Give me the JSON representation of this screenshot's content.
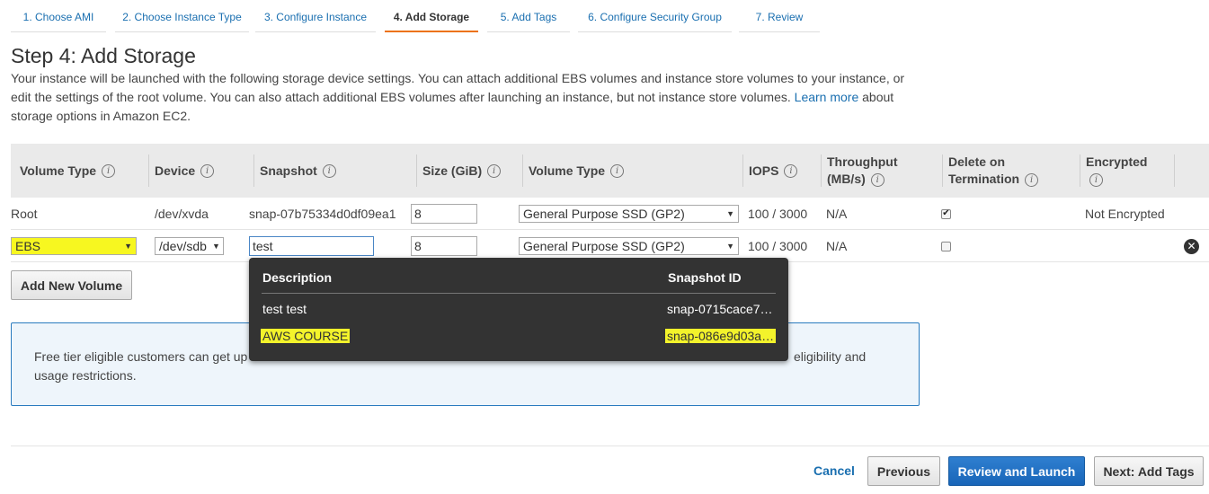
{
  "wizard": {
    "tabs": [
      {
        "label": "1. Choose AMI"
      },
      {
        "label": "2. Choose Instance Type"
      },
      {
        "label": "3. Configure Instance"
      },
      {
        "label": "4. Add Storage"
      },
      {
        "label": "5. Add Tags"
      },
      {
        "label": "6. Configure Security Group"
      },
      {
        "label": "7. Review"
      }
    ],
    "active_index": 3
  },
  "page": {
    "title": "Step 4: Add Storage",
    "intro_part1": "Your instance will be launched with the following storage device settings. You can attach additional EBS volumes and instance store volumes to your instance, or edit the settings of the root volume. You can also attach additional EBS volumes after launching an instance, but not instance store volumes.",
    "learn_more": "Learn more",
    "intro_part2": "about storage options in Amazon EC2."
  },
  "table": {
    "headers": {
      "volume_type": "Volume Type",
      "device": "Device",
      "snapshot": "Snapshot",
      "size": "Size (GiB)",
      "volume_type2": "Volume Type",
      "iops": "IOPS",
      "throughput_line1": "Throughput",
      "throughput_line2": "(MB/s)",
      "delete_line1": "Delete on",
      "delete_line2": "Termination",
      "encrypted": "Encrypted"
    },
    "rows": [
      {
        "volume_type": "Root",
        "device": "/dev/xvda",
        "snapshot": "snap-07b75334d0df09ea1",
        "size": "8",
        "ebs_type": "General Purpose SSD (GP2)",
        "iops": "100 / 3000",
        "throughput": "N/A",
        "delete_on_termination": true,
        "encrypted": "Not Encrypted"
      },
      {
        "volume_type": "EBS",
        "device": "/dev/sdb",
        "snapshot": "test",
        "size": "8",
        "ebs_type": "General Purpose SSD (GP2)",
        "iops": "100 / 3000",
        "throughput": "N/A",
        "delete_on_termination": false,
        "encrypted": ""
      }
    ]
  },
  "add_volume_button": "Add New Volume",
  "free_tier": {
    "text_part1": "Free tier eligible customers can get up",
    "text_part2": "eligibility and",
    "text_part3": "usage restrictions."
  },
  "snapshot_dropdown": {
    "header_description": "Description",
    "header_snapshot_id": "Snapshot ID",
    "items": [
      {
        "description": "test test",
        "snapshot_id": "snap-0715cace7…"
      },
      {
        "description": "AWS COURSE",
        "snapshot_id": "snap-086e9d03a…"
      }
    ]
  },
  "footer": {
    "cancel": "Cancel",
    "previous": "Previous",
    "review_launch": "Review and Launch",
    "next": "Next: Add Tags"
  },
  "colors": {
    "link": "#1a6fb0",
    "active_tab_underline": "#ec7211",
    "primary_button": "#1865b8",
    "highlight": "#f7f720",
    "dropdown_bg": "#333333"
  }
}
